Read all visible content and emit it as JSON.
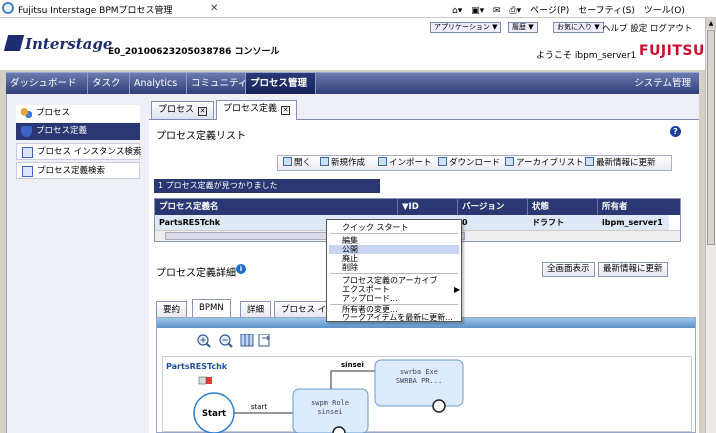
{
  "browser": {
    "title": "Fujitsu Interstage BPMプロセス管理",
    "close_glyph": "✕",
    "tools": [
      "ページ(P)",
      "セーフティ(S)",
      "ツール(O)"
    ]
  },
  "header": {
    "logo": "Interstage",
    "org": "E0_20100623205038786 コンソール",
    "buttons": [
      "アプリケーション ▼",
      "履歴 ▼",
      "お気に入り ▼"
    ],
    "links": "ヘルプ 設定 ログアウト",
    "welcome": "ようこそ ibpm_server1",
    "brand": "FUJITSU"
  },
  "nav": {
    "items": [
      "ダッシュボード",
      "タスク",
      "Analytics",
      "コミュニティ",
      "プロセス管理"
    ],
    "right": "システム管理"
  },
  "sidebar": {
    "items": [
      "プロセス",
      "プロセス定義",
      "プロセス インスタンス検索",
      "プロセス定義検索"
    ]
  },
  "tabs": {
    "process": "プロセス",
    "definition": "プロセス定義",
    "close": "✕"
  },
  "list": {
    "title": "プロセス定義リスト",
    "help": "?",
    "toolbar": [
      "開く",
      "新規作成",
      "インポート",
      "ダウンロード",
      "アーカイブリスト",
      "最新情報に更新"
    ],
    "found": "1 プロセス定義が見つかりました",
    "columns": [
      "プロセス定義名",
      "▼ID",
      "バージョン",
      "状態",
      "所有者"
    ],
    "row": {
      "name": "PartsRESTchk",
      "id": "",
      "version": "0",
      "status": "ドラフト",
      "owner": "ibpm_server1"
    }
  },
  "context_menu": {
    "items": [
      "クイック スタート",
      "編集",
      "公開",
      "廃止",
      "削除",
      "プロセス定義のアーカイブ",
      "エクスポート",
      "アップロード...",
      "所有者の変更...",
      "ワークアイテムを最新に更新..."
    ],
    "submenu_arrow": "▶"
  },
  "details": {
    "title": "プロセス定義詳細",
    "info": "i",
    "full_button": "全画面表示",
    "refresh_button": "最新情報に更新",
    "tabs": [
      "要約",
      "BPMN",
      "詳細",
      "プロセス イ"
    ]
  },
  "bpmn": {
    "process_name": "PartsRESTchk",
    "start": "Start",
    "flow_start": "start",
    "flow_sinsei": "sinsei",
    "role_title": "swpm Role",
    "role_sub": "sinsei",
    "exe_title": "swrba Exe",
    "exe_sub": "SWRBA PR..."
  }
}
